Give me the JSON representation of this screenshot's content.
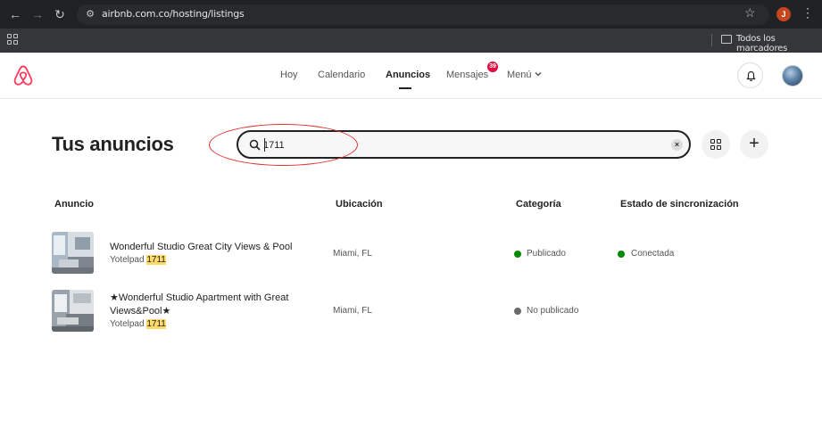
{
  "browser": {
    "url": "airbnb.com.co/hosting/listings",
    "profile_initial": "J",
    "bookmarks_label": "Todos los marcadores"
  },
  "header": {
    "nav": [
      {
        "label": "Hoy"
      },
      {
        "label": "Calendario"
      },
      {
        "label": "Anuncios",
        "active": true
      },
      {
        "label": "Mensajes"
      },
      {
        "label": "Menú"
      }
    ],
    "messages_badge": "39"
  },
  "main": {
    "title": "Tus anuncios",
    "search": {
      "value": "1711"
    },
    "columns": [
      "Anuncio",
      "Ubicación",
      "Categoría",
      "Estado de sincronización"
    ],
    "listings": [
      {
        "title": "Wonderful Studio Great City Views & Pool",
        "sub_prefix": "Yotelpad ",
        "sub_highlight": "1711",
        "location": "Miami, FL",
        "category": "Publicado",
        "category_color": "#008a05",
        "sync": "Conectada",
        "sync_color": "#008a05"
      },
      {
        "title": "★Wonderful Studio Apartment with Great Views&Pool★",
        "sub_prefix": "Yotelpad ",
        "sub_highlight": "1711",
        "location": "Miami, FL",
        "category": "No publicado",
        "category_color": "#6a6a6a",
        "sync": "",
        "sync_color": ""
      }
    ]
  },
  "colors": {
    "brand": "#ff385c",
    "annotation": "#e0302b"
  }
}
